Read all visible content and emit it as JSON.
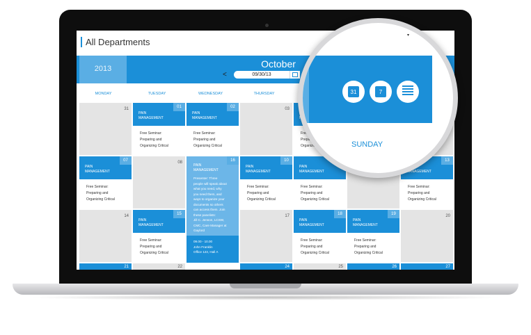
{
  "header": {
    "title": "All Departments"
  },
  "calendar": {
    "year": "2013",
    "month": "October",
    "date_value": "09/30/13",
    "prev": "<",
    "weekdays": [
      "MONDAY",
      "TUESDAY",
      "WEDNESDAY",
      "THURSDAY"
    ],
    "event_title_line1": "PAIN",
    "event_title_line2": "MANAGEMENT",
    "event_desc_line1": "Free Seminar:",
    "event_desc_line2": "Preparing and",
    "event_desc_line3": "Organizing Critical",
    "popup": {
      "lines": [
        "Presenter: Three",
        "people will speak about",
        "what you need, why",
        "you need them, and",
        "ways to organize your",
        "documents so others",
        "can access them. Join",
        "these panelists:",
        "Jill C. Jenson, LCSW,",
        "CMC, Care Manager at",
        "Gaylord"
      ],
      "time": "09.00 - 10.00",
      "person": "John Franklin",
      "office": "Office 123, Hall A"
    },
    "days": {
      "d31": "31",
      "d01": "01",
      "d02": "02",
      "d03": "03",
      "d04": "04",
      "d05": "05",
      "d07": "07",
      "d08": "08",
      "d16": "16",
      "d10": "10",
      "d11": "11",
      "d12": "12",
      "d13": "13",
      "d14": "14",
      "d15": "15",
      "d17": "17",
      "d18": "18",
      "d19": "19",
      "d20": "20",
      "d21": "21",
      "d22": "22",
      "d23": "23",
      "d24": "24",
      "d25": "25",
      "d26": "26",
      "d27": "27"
    }
  },
  "magnifier": {
    "day_label": "SUNDAY",
    "month_icon_num": "31",
    "week_icon_num": "7"
  },
  "colors": {
    "accent": "#1b8fd8",
    "light_accent": "#5aaee4",
    "cell": "#e4e4e4"
  }
}
